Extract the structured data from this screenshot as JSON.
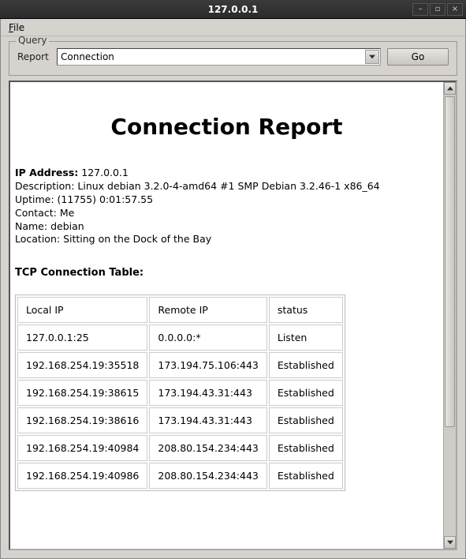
{
  "titlebar": {
    "title": "127.0.0.1",
    "minimize": "_",
    "maximize": "□",
    "close": "×"
  },
  "menubar": {
    "file": "File"
  },
  "query": {
    "legend": "Query",
    "report_label": "Report",
    "selected": "Connection",
    "go_label": "Go"
  },
  "report": {
    "title": "Connection Report",
    "ip_label": "IP Address:",
    "ip_value": "127.0.0.1",
    "description_label": "Description:",
    "description_value": "Linux debian 3.2.0-4-amd64 #1 SMP Debian 3.2.46-1 x86_64",
    "uptime_label": "Uptime:",
    "uptime_value": "(11755) 0:01:57.55",
    "contact_label": "Contact:",
    "contact_value": "Me",
    "name_label": "Name:",
    "name_value": "debian",
    "location_label": "Location:",
    "location_value": "Sitting on the Dock of the Bay",
    "table_title": "TCP Connection Table:",
    "columns": {
      "local": "Local IP",
      "remote": "Remote IP",
      "status": "status"
    },
    "rows": [
      {
        "local": "127.0.0.1:25",
        "remote": "0.0.0.0:*",
        "status": "Listen"
      },
      {
        "local": "192.168.254.19:35518",
        "remote": "173.194.75.106:443",
        "status": "Established"
      },
      {
        "local": "192.168.254.19:38615",
        "remote": "173.194.43.31:443",
        "status": "Established"
      },
      {
        "local": "192.168.254.19:38616",
        "remote": "173.194.43.31:443",
        "status": "Established"
      },
      {
        "local": "192.168.254.19:40984",
        "remote": "208.80.154.234:443",
        "status": "Established"
      },
      {
        "local": "192.168.254.19:40986",
        "remote": "208.80.154.234:443",
        "status": "Established"
      }
    ]
  }
}
